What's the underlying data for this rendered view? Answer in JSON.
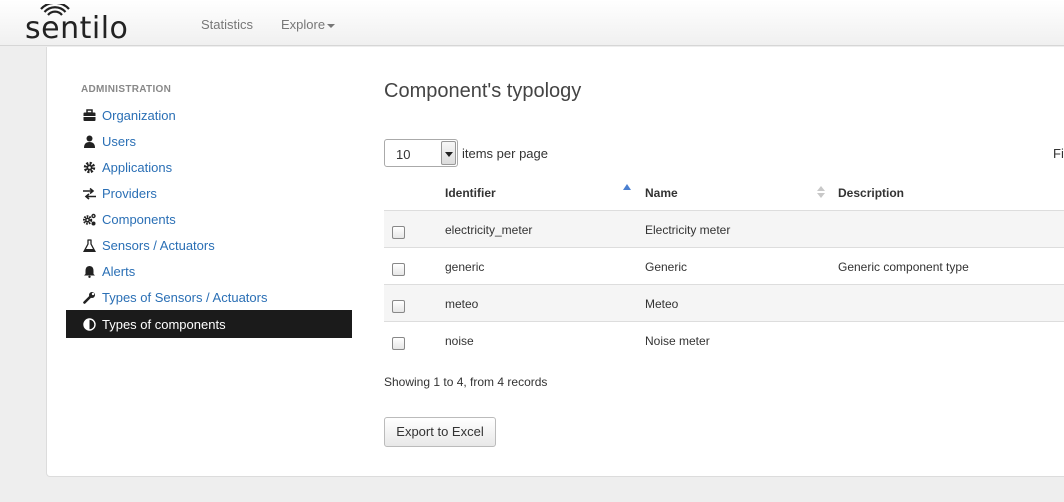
{
  "navbar": {
    "logo_text": "sentilo",
    "links": [
      {
        "label": "Statistics"
      },
      {
        "label": "Explore"
      }
    ]
  },
  "sidebar": {
    "header": "ADMINISTRATION",
    "items": [
      {
        "label": "Organization",
        "icon": "briefcase-icon"
      },
      {
        "label": "Users",
        "icon": "user-icon"
      },
      {
        "label": "Applications",
        "icon": "gear-icon"
      },
      {
        "label": "Providers",
        "icon": "exchange-icon"
      },
      {
        "label": "Components",
        "icon": "cogs-icon"
      },
      {
        "label": "Sensors / Actuators",
        "icon": "flask-icon"
      },
      {
        "label": "Alerts",
        "icon": "bell-icon"
      },
      {
        "label": "Types of Sensors / Actuators",
        "icon": "wrench-icon"
      },
      {
        "label": "Types of components",
        "icon": "half-circle-icon",
        "active": true
      }
    ]
  },
  "main": {
    "title": "Component's typology",
    "per_page_value": "10",
    "per_page_label": "items per page",
    "filter_label": "Fi",
    "table": {
      "headers": [
        "Identifier",
        "Name",
        "Description"
      ],
      "rows": [
        {
          "identifier": "electricity_meter",
          "name": "Electricity meter",
          "description": ""
        },
        {
          "identifier": "generic",
          "name": "Generic",
          "description": "Generic component type"
        },
        {
          "identifier": "meteo",
          "name": "Meteo",
          "description": ""
        },
        {
          "identifier": "noise",
          "name": "Noise meter",
          "description": ""
        }
      ]
    },
    "showing": "Showing 1 to 4, from 4 records",
    "export_label": "Export to Excel"
  },
  "colors": {
    "link": "#2a6fb5",
    "active_bg": "#1b1b1b",
    "sort_active": "#4a7fd0"
  }
}
